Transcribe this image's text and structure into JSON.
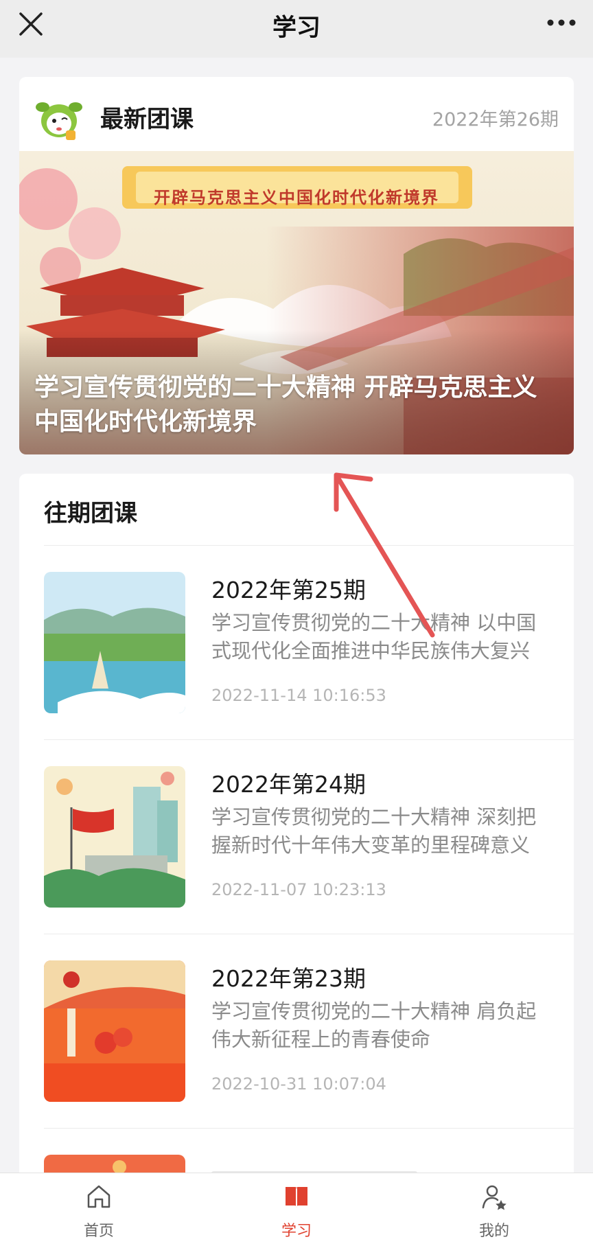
{
  "navbar": {
    "title": "学习",
    "close_icon": "close-icon",
    "more_icon": "more-dots-icon"
  },
  "latest": {
    "title": "最新团课",
    "issue": "2022年第26期",
    "banner_ribbon_text": "开辟马克思主义中国化时代化新境界",
    "banner_caption": "学习宣传贯彻党的二十大精神 开辟马克思主义中国化时代化新境界"
  },
  "past": {
    "heading": "往期团课",
    "items": [
      {
        "title": "2022年第25期",
        "desc": "学习宣传贯彻党的二十大精神 以中国式现代化全面推进中华民族伟大复兴",
        "date": "2022-11-14 10:16:53"
      },
      {
        "title": "2022年第24期",
        "desc": "学习宣传贯彻党的二十大精神 深刻把握新时代十年伟大变革的里程碑意义",
        "date": "2022-11-07 10:23:13"
      },
      {
        "title": "2022年第23期",
        "desc": "学习宣传贯彻党的二十大精神 肩负起伟大新征程上的青春使命",
        "date": "2022-10-31 10:07:04"
      }
    ]
  },
  "tabbar": {
    "tabs": [
      {
        "label": "首页",
        "icon": "home-icon"
      },
      {
        "label": "学习",
        "icon": "book-icon"
      },
      {
        "label": "我的",
        "icon": "profile-star-icon"
      }
    ],
    "active_index": 1
  },
  "colors": {
    "accent": "#e0412f",
    "background": "#f3f3f5",
    "muted_text": "#8a8a8a",
    "date_text": "#b5b5b5"
  }
}
